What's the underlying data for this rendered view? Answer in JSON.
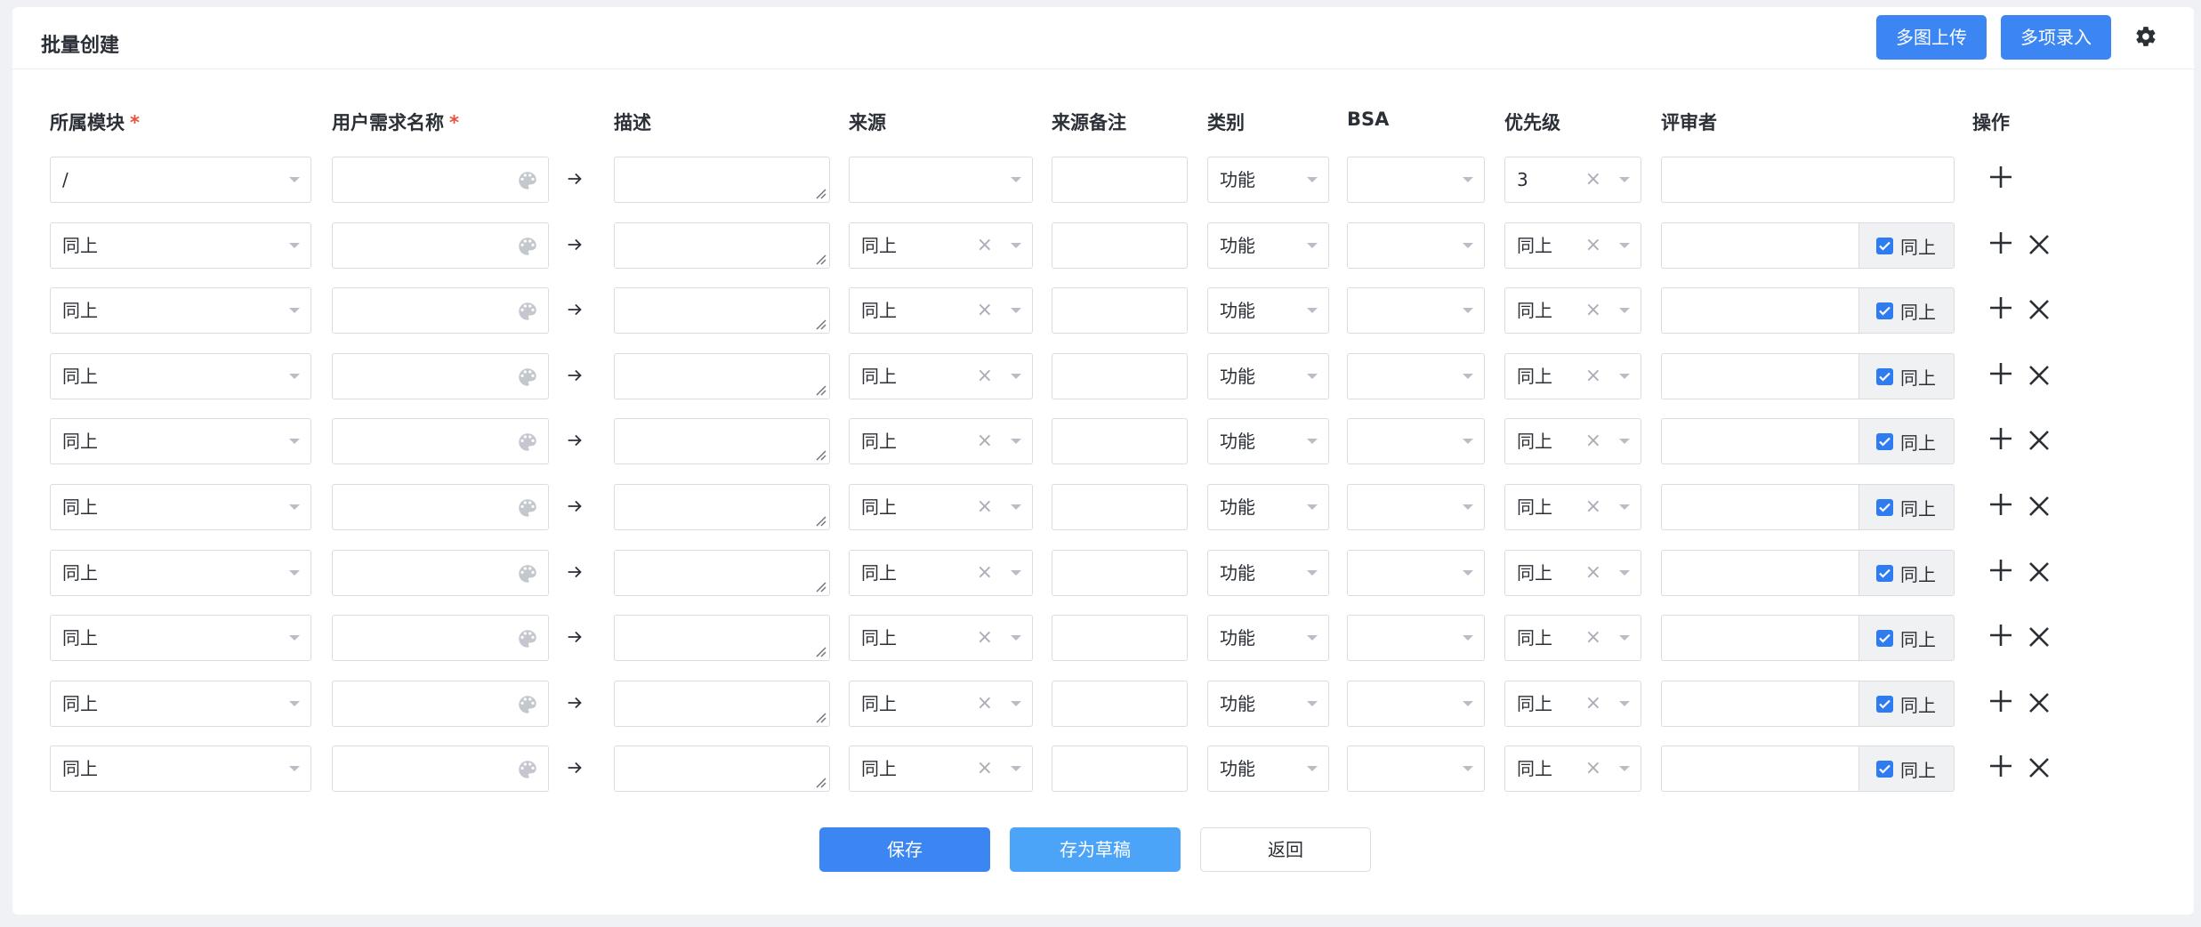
{
  "page": {
    "title": "批量创建"
  },
  "toolbar": {
    "multi_image_upload": "多图上传",
    "multi_entry": "多项录入"
  },
  "icons": {
    "settings": "gear-icon",
    "palette": "palette-icon",
    "arrow": "arrow-right-icon",
    "add": "plus-icon",
    "remove": "close-icon"
  },
  "columns": {
    "module": "所属模块",
    "name": "用户需求名称",
    "required_mark": "*",
    "desc": "描述",
    "source": "来源",
    "source_note": "来源备注",
    "category": "类别",
    "bsa": "BSA",
    "priority": "优先级",
    "reviewer": "评审者",
    "ops": "操作"
  },
  "rows": [
    {
      "module": "/",
      "source": "",
      "category": "功能",
      "priority": "3",
      "reviewer_same": false
    },
    {
      "module": "同上",
      "source": "同上",
      "category": "功能",
      "priority": "同上",
      "reviewer_same": true,
      "same_label": "同上"
    },
    {
      "module": "同上",
      "source": "同上",
      "category": "功能",
      "priority": "同上",
      "reviewer_same": true,
      "same_label": "同上"
    },
    {
      "module": "同上",
      "source": "同上",
      "category": "功能",
      "priority": "同上",
      "reviewer_same": true,
      "same_label": "同上"
    },
    {
      "module": "同上",
      "source": "同上",
      "category": "功能",
      "priority": "同上",
      "reviewer_same": true,
      "same_label": "同上"
    },
    {
      "module": "同上",
      "source": "同上",
      "category": "功能",
      "priority": "同上",
      "reviewer_same": true,
      "same_label": "同上"
    },
    {
      "module": "同上",
      "source": "同上",
      "category": "功能",
      "priority": "同上",
      "reviewer_same": true,
      "same_label": "同上"
    },
    {
      "module": "同上",
      "source": "同上",
      "category": "功能",
      "priority": "同上",
      "reviewer_same": true,
      "same_label": "同上"
    },
    {
      "module": "同上",
      "source": "同上",
      "category": "功能",
      "priority": "同上",
      "reviewer_same": true,
      "same_label": "同上"
    },
    {
      "module": "同上",
      "source": "同上",
      "category": "功能",
      "priority": "同上",
      "reviewer_same": true,
      "same_label": "同上"
    }
  ],
  "footer": {
    "save": "保存",
    "save_draft": "存为草稿",
    "back": "返回"
  },
  "colors": {
    "primary": "#3c86f4",
    "draft": "#4ba4f7",
    "required": "#e8503d"
  }
}
